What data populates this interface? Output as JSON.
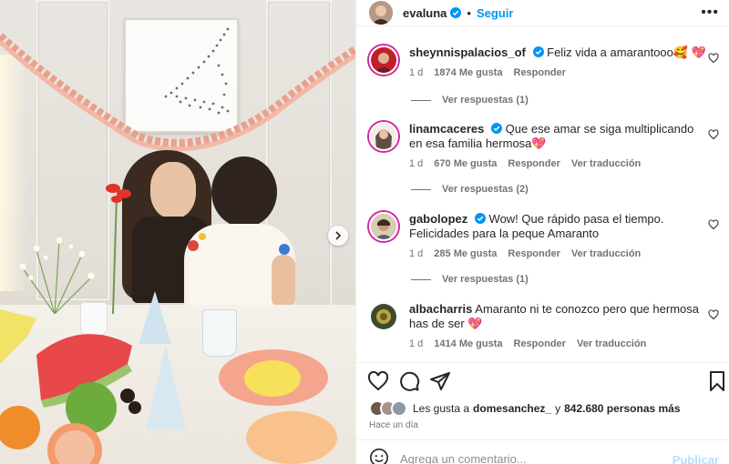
{
  "post": {
    "username": "evaluna",
    "follow_label": "Seguir",
    "more_label": "•••"
  },
  "comments": [
    {
      "username": "sheynnispalacios_of",
      "verified": true,
      "text": "Feliz vida a amarantooo🥰 💖",
      "time": "1 d",
      "likes": "1874 Me gusta",
      "reply": "Responder",
      "translate": "",
      "view_replies": "Ver respuestas (1)"
    },
    {
      "username": "linamcaceres",
      "verified": true,
      "text": "Que ese amar se siga multiplicando en esa familia hermosa💖",
      "time": "1 d",
      "likes": "670 Me gusta",
      "reply": "Responder",
      "translate": "Ver traducción",
      "view_replies": "Ver respuestas (2)"
    },
    {
      "username": "gabolopez",
      "verified": true,
      "text": "Wow! Que rápido pasa el tiempo. Felicidades para la peque Amaranto",
      "time": "1 d",
      "likes": "285 Me gusta",
      "reply": "Responder",
      "translate": "Ver traducción",
      "view_replies": "Ver respuestas (1)"
    },
    {
      "username": "albacharris",
      "verified": false,
      "text": "Amaranto ni te conozco pero que hermosa has de ser 💖",
      "time": "1 d",
      "likes": "1414 Me gusta",
      "reply": "Responder",
      "translate": "Ver traducción",
      "view_replies": ""
    }
  ],
  "likes_summary": {
    "prefix": "Les gusta a",
    "user": "domesanchez_",
    "connector": "y",
    "count": "842.680 personas más"
  },
  "timestamp": "Hace un día",
  "add_comment": {
    "placeholder": "Agrega un comentario...",
    "publish_label": "Publicar"
  },
  "icons": [
    "heart-icon",
    "comment-icon",
    "share-icon",
    "bookmark-icon",
    "emoji-icon",
    "verified-icon",
    "chevron-right-icon",
    "more-icon"
  ],
  "colors": {
    "accent": "#0095f6",
    "publish_disabled": "#b2dffc",
    "secondary_text": "#737373",
    "verified": "#0095f6",
    "heart": "#ed4956"
  }
}
